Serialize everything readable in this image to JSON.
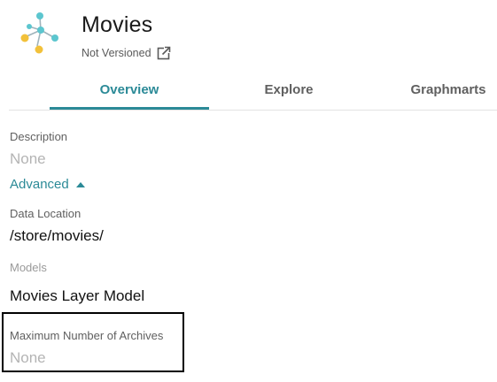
{
  "header": {
    "title": "Movies",
    "version_status": "Not Versioned",
    "logo_icon": "graph-nodes-icon",
    "external_link_icon": "external-link-icon"
  },
  "tabs": [
    {
      "label": "Overview",
      "active": true
    },
    {
      "label": "Explore",
      "active": false
    },
    {
      "label": "Graphmarts",
      "active": false
    }
  ],
  "fields": {
    "description": {
      "label": "Description",
      "value": "None"
    },
    "advanced": {
      "label": "Advanced",
      "icon": "caret-up-icon"
    },
    "data_location": {
      "label": "Data Location",
      "value": "/store/movies/"
    },
    "models": {
      "label": "Models",
      "value": "Movies Layer Model"
    },
    "max_archives": {
      "label": "Maximum Number of Archives",
      "value": "None"
    }
  },
  "colors": {
    "accent": "#2b8a97",
    "text": "#111111",
    "muted": "#9a9a9a",
    "placeholder": "#b4b4b4",
    "node_teal": "#5cc6cf",
    "node_yellow": "#f2c13a"
  }
}
